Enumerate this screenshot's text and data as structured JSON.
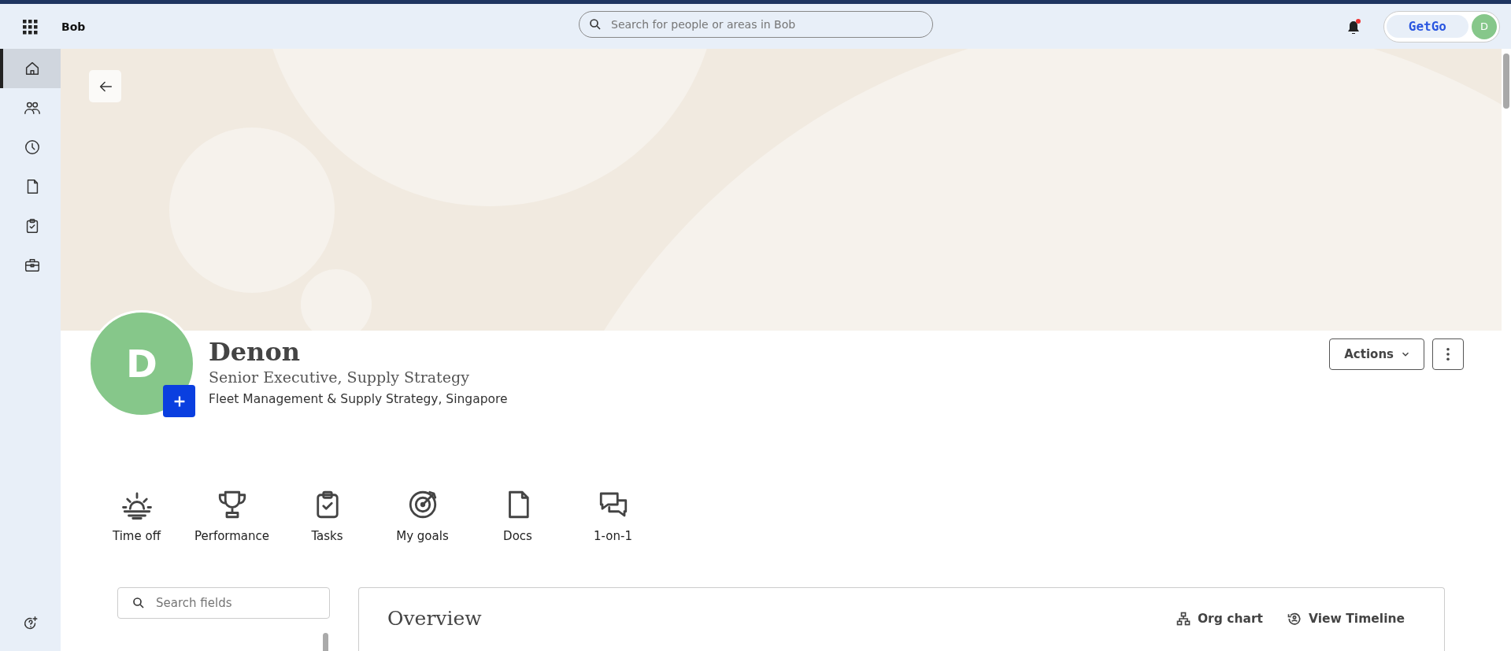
{
  "top_bar": {
    "app_name": "Bob",
    "search": {
      "placeholder": "Search for people or areas in Bob"
    },
    "company_logo": "GetGo",
    "user_initial": "D"
  },
  "sidebar": {
    "items": [
      {
        "kind": "home",
        "selected": true
      },
      {
        "kind": "people",
        "selected": false
      },
      {
        "kind": "clock",
        "selected": false
      },
      {
        "kind": "doc",
        "selected": false
      },
      {
        "kind": "tasks",
        "selected": false
      },
      {
        "kind": "briefcase",
        "selected": false
      }
    ]
  },
  "profile": {
    "initial": "D",
    "name": "Denon",
    "title": "Senior Executive, Supply Strategy",
    "department": "Fleet Management & Supply Strategy, Singapore",
    "actions_button": "Actions"
  },
  "shortcuts": [
    {
      "kind": "sun",
      "label": "Time off"
    },
    {
      "kind": "trophy",
      "label": "Performance"
    },
    {
      "kind": "tasks",
      "label": "Tasks"
    },
    {
      "kind": "target",
      "label": "My goals"
    },
    {
      "kind": "doc",
      "label": "Docs"
    },
    {
      "kind": "chat",
      "label": "1-on-1"
    }
  ],
  "field_search": {
    "placeholder": "Search fields"
  },
  "overview": {
    "title": "Overview",
    "links": [
      {
        "kind": "org",
        "label": "Org chart"
      },
      {
        "kind": "timeline",
        "label": "View Timeline"
      }
    ]
  }
}
